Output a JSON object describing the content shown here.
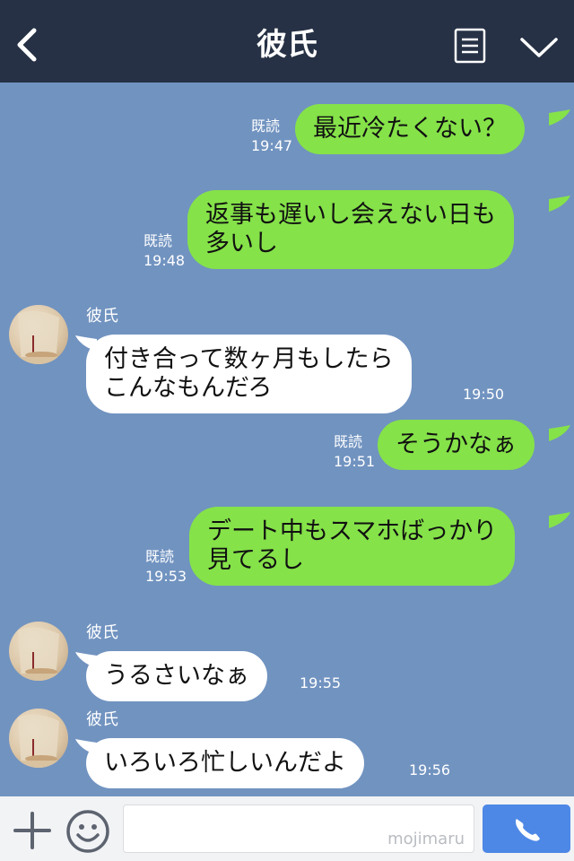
{
  "header": {
    "title": "彼氏",
    "back_icon": "back-chevron-icon",
    "menu_icon": "menu-list-icon",
    "collapse_icon": "chevron-down-icon",
    "bg_color": "#263145"
  },
  "chat": {
    "bg_color": "#7193c0",
    "outgoing_color": "#85e249",
    "incoming_color": "#ffffff",
    "messages": [
      {
        "direction": "out",
        "read": "既読",
        "time": "19:47",
        "lines": [
          "最近冷たくない？"
        ]
      },
      {
        "direction": "out",
        "read": "既読",
        "time": "19:48",
        "lines": [
          "返事も遅いし会えない日も",
          "多いし"
        ]
      },
      {
        "direction": "in",
        "sender": "彼氏",
        "time": "19:50",
        "lines": [
          "付き合って数ヶ月もしたら",
          "こんなもんだろ"
        ]
      },
      {
        "direction": "out",
        "read": "既読",
        "time": "19:51",
        "lines": [
          "そうかなぁ"
        ]
      },
      {
        "direction": "out",
        "read": "既読",
        "time": "19:53",
        "lines": [
          "デート中もスマホばっかり",
          "見てるし"
        ]
      },
      {
        "direction": "in",
        "sender": "彼氏",
        "time": "19:55",
        "lines": [
          "うるさいなぁ"
        ]
      },
      {
        "direction": "in",
        "sender": "彼氏",
        "time": "19:56",
        "lines": [
          "いろいろ忙しいんだよ"
        ]
      }
    ]
  },
  "footer": {
    "plus_icon": "plus-icon",
    "emoji_icon": "smiley-icon",
    "watermark": "mojimaru",
    "call_icon": "phone-icon",
    "call_color": "#4d88e6"
  }
}
